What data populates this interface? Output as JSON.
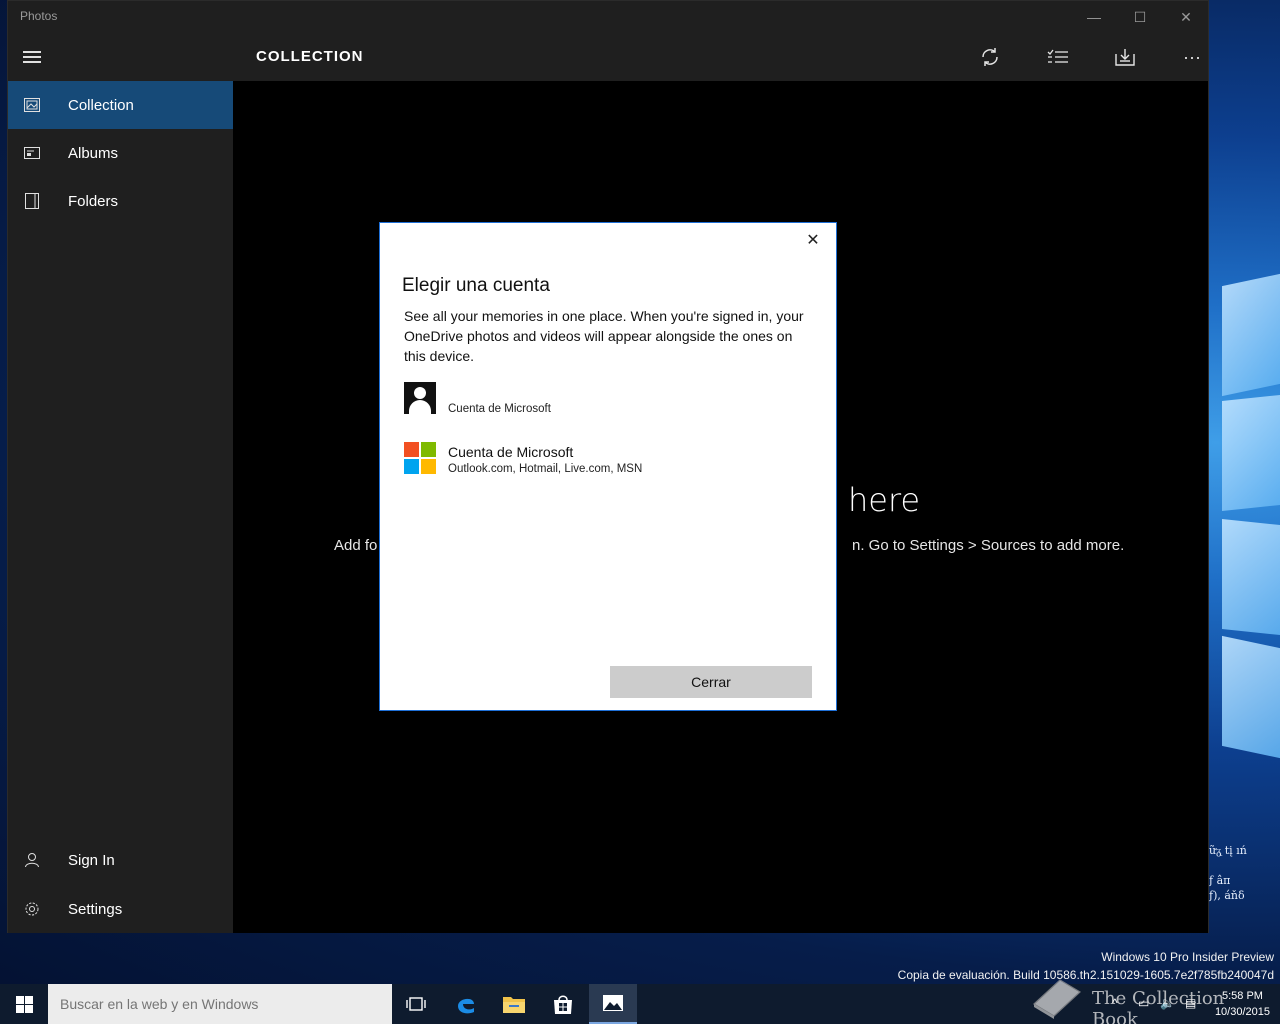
{
  "window": {
    "title": "Photos",
    "minimize": "—",
    "maximize": "☐",
    "close": "✕"
  },
  "sidebar": {
    "items": [
      {
        "label": "Collection",
        "icon": "collection-icon"
      },
      {
        "label": "Albums",
        "icon": "album-icon"
      },
      {
        "label": "Folders",
        "icon": "folder-icon"
      }
    ],
    "sign_in": "Sign In",
    "settings": "Settings"
  },
  "header": {
    "title": "COLLECTION",
    "buttons": [
      "refresh-icon",
      "select-icon",
      "import-icon",
      "more-icon"
    ],
    "more_label": "···"
  },
  "content": {
    "empty_title_visible": "here",
    "empty_body_left": "Add fo",
    "empty_body_right": "n. Go to Settings > Sources to add more."
  },
  "dialog": {
    "title": "Elegir una cuenta",
    "description": "See all your memories in one place. When you're signed in, your OneDrive photos and videos will appear alongside the ones on this device.",
    "accounts": [
      {
        "line1": "",
        "line2": "Cuenta de Microsoft",
        "icon": "person-icon"
      },
      {
        "line1": "Cuenta de Microsoft",
        "line2": "Outlook.com, Hotmail, Live.com, MSN",
        "icon": "microsoft-logo-icon"
      }
    ],
    "close_button": "Cerrar",
    "close_x": "✕"
  },
  "desktop": {
    "side_text": [
      "ữᵹ̨ tį ıń",
      "ƒ âπ",
      "ƒ), áňδ"
    ],
    "watermark_line1": "Windows 10 Pro Insider Preview",
    "watermark_line2": "Copia de evaluación. Build 10586.th2.151029-1605.7e2f785fb240047d",
    "overlay_text": "The Collection Book"
  },
  "taskbar": {
    "search_placeholder": "Buscar en la web y en Windows",
    "apps": [
      "task-view-icon",
      "edge-icon",
      "file-explorer-icon",
      "store-icon",
      "photos-icon"
    ],
    "time": "5:58 PM",
    "date": "10/30/2015"
  },
  "colors": {
    "accent": "#164a78",
    "dialog_border": "#1e6fd6",
    "ms_red": "#f25022",
    "ms_green": "#7fba00",
    "ms_blue": "#00a4ef",
    "ms_yellow": "#ffb900"
  }
}
